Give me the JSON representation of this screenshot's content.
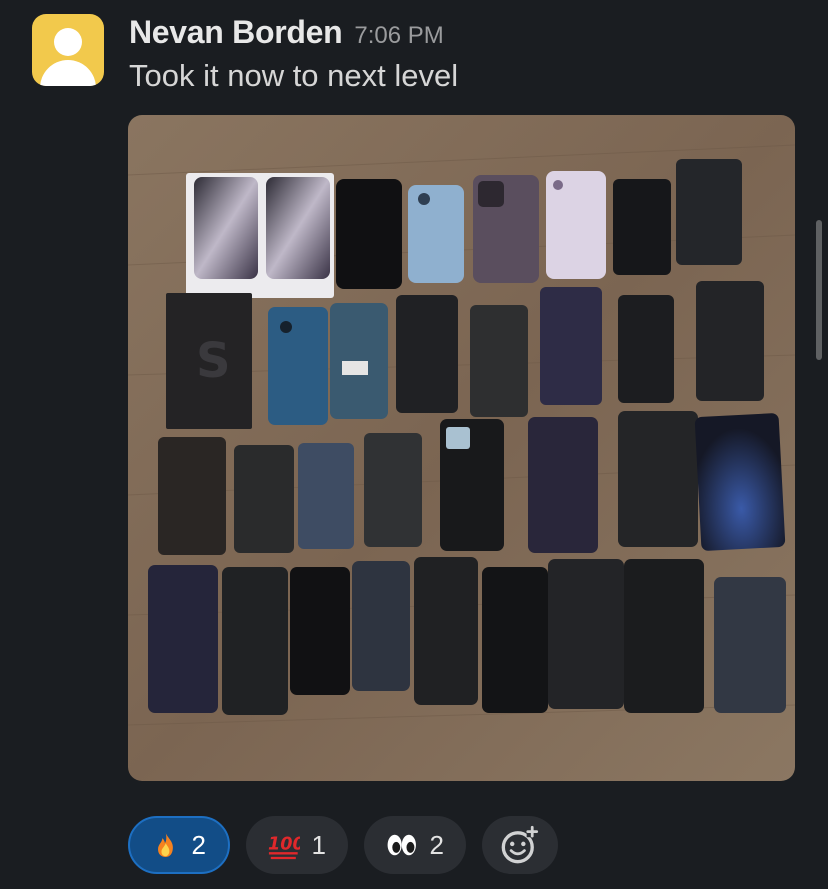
{
  "message": {
    "author": "Nevan Borden",
    "time": "7:06 PM",
    "text": "Took it now to next level"
  },
  "avatar": {
    "color": "#f2c94c"
  },
  "image": {
    "description_icon": "image-attachment"
  },
  "reactions": [
    {
      "emoji": "fire",
      "count": "2",
      "active": true
    },
    {
      "emoji": "hundred",
      "count": "1",
      "active": false
    },
    {
      "emoji": "eyes",
      "count": "2",
      "active": false
    }
  ],
  "colors": {
    "background": "#1a1d21",
    "active_reaction": "#124d87",
    "reaction": "#2b2e33"
  }
}
